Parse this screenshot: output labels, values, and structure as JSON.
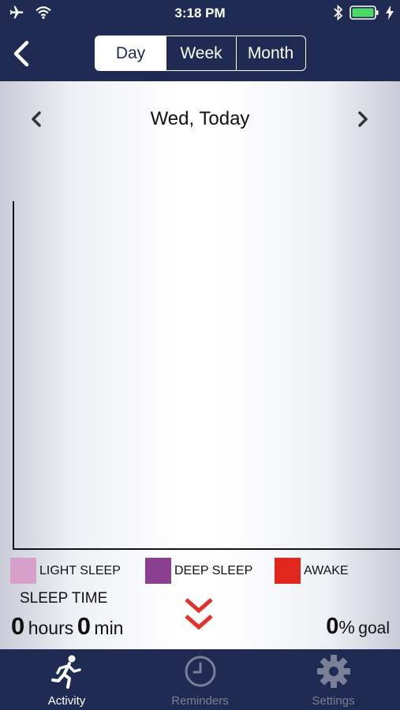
{
  "status_bar": {
    "time": "3:18 PM",
    "icons": [
      "airplane-icon",
      "wifi-icon",
      "bluetooth-icon",
      "battery-icon",
      "charging-icon"
    ],
    "battery_color": "#4cd964"
  },
  "header": {
    "background": "#1f2b52",
    "segments": [
      {
        "label": "Day",
        "active": true
      },
      {
        "label": "Week",
        "active": false
      },
      {
        "label": "Month",
        "active": false
      }
    ]
  },
  "date_nav": {
    "label": "Wed, Today"
  },
  "legend": [
    {
      "label": "LIGHT SLEEP",
      "color": "#d7a0cb"
    },
    {
      "label": "DEEP SLEEP",
      "color": "#8b3f8f"
    },
    {
      "label": "AWAKE",
      "color": "#e1261c"
    }
  ],
  "summary": {
    "sleep_time_label": "SLEEP TIME",
    "hours_value": "0",
    "hours_unit": "hours",
    "minutes_value": "0",
    "minutes_unit": "min",
    "goal_value": "0",
    "goal_percent_sign": "%",
    "goal_word": "goal"
  },
  "tabs": [
    {
      "label": "Activity",
      "icon": "runner-icon",
      "active": true
    },
    {
      "label": "Reminders",
      "icon": "clock-icon",
      "active": false
    },
    {
      "label": "Settings",
      "icon": "gear-icon",
      "active": false
    }
  ],
  "colors": {
    "tab_active": "#ffffff",
    "tab_inactive": "#7a8097",
    "chevron": "#e0322a"
  }
}
